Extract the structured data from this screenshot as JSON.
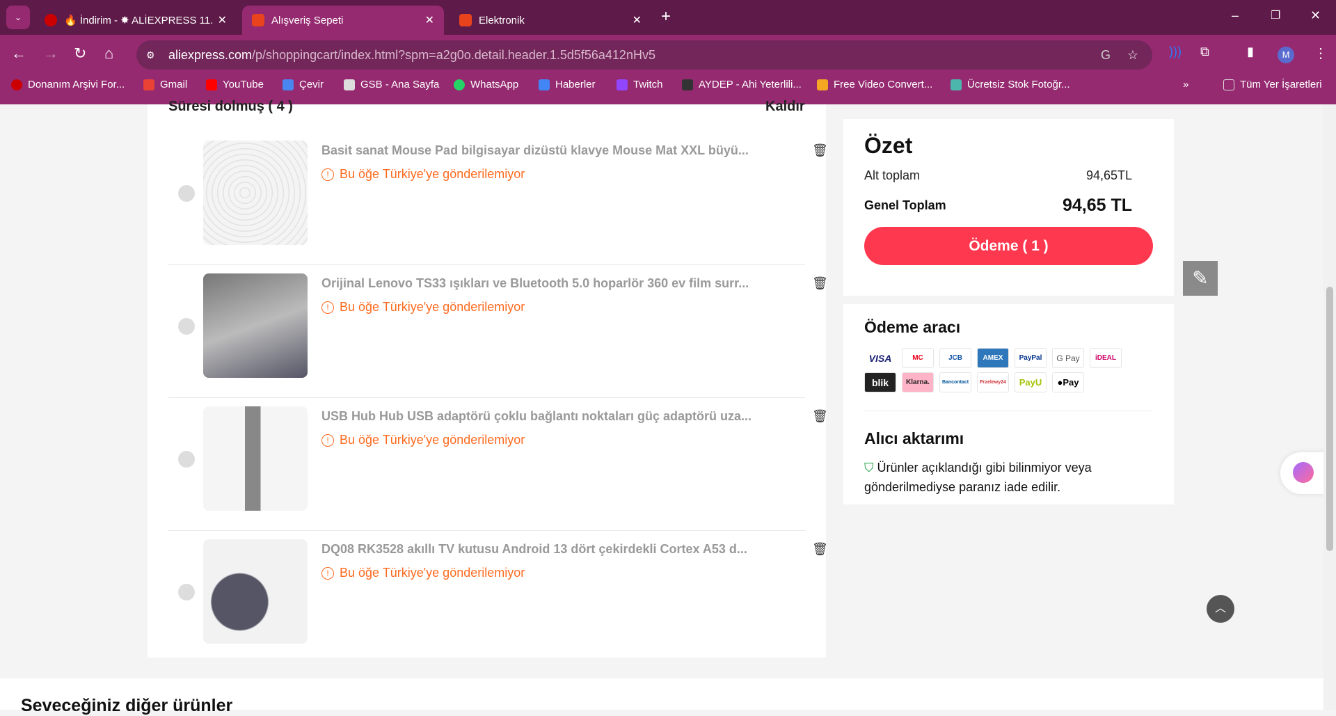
{
  "browser": {
    "tabs": [
      {
        "label": "🔥 İndirim - ✸ ALİEXPRESS 11.",
        "active": false
      },
      {
        "label": "Alışveriş Sepeti",
        "active": true
      },
      {
        "label": "Elektronik",
        "active": false
      }
    ],
    "url_host": "aliexpress.com",
    "url_path": "/p/shoppingcart/index.html?spm=a2g0o.detail.header.1.5d5f56a412nHv5",
    "profile": "M",
    "bookmarks": [
      "Donanım Arşivi For...",
      "Gmail",
      "YouTube",
      "Çevir",
      "GSB - Ana Sayfa",
      "WhatsApp",
      "Haberler",
      "Twitch",
      "AYDEP - Ahi Yeterlili...",
      "Free Video Convert...",
      "Ücretsiz Stok Fotoğr..."
    ],
    "all_bookmarks": "Tüm Yer İşaretleri"
  },
  "cart": {
    "section_title": "Süresi dolmuş ( 4 )",
    "remove_label": "Kaldır",
    "items": [
      {
        "title": "Basit sanat Mouse Pad bilgisayar dizüstü klavye Mouse Mat XXL büyü...",
        "warning": "Bu öğe Türkiye'ye gönderilemiyor"
      },
      {
        "title": "Orijinal Lenovo TS33 ışıkları ve Bluetooth 5.0 hoparlör 360 ev film surr...",
        "warning": "Bu öğe Türkiye'ye gönderilemiyor"
      },
      {
        "title": "USB Hub Hub USB adaptörü çoklu bağlantı noktaları güç adaptörü uza...",
        "warning": "Bu öğe Türkiye'ye gönderilemiyor"
      },
      {
        "title": "DQ08 RK3528 akıllı TV kutusu Android 13 dört çekirdekli Cortex A53 d...",
        "warning": "Bu öğe Türkiye'ye gönderilemiyor"
      }
    ]
  },
  "summary": {
    "title": "Özet",
    "subtotal_label": "Alt toplam",
    "subtotal": "94,65TL",
    "total_label": "Genel Toplam",
    "total": "94,65 TL",
    "checkout": "Ödeme ( 1 )"
  },
  "payment": {
    "title": "Ödeme aracı",
    "methods": [
      "VISA",
      "MC",
      "JCB",
      "AMEX",
      "PayPal",
      "G Pay",
      "iDEAL",
      "blik",
      "Klarna.",
      "Bancontact",
      "Przelewy24",
      "PayU",
      "Pay"
    ]
  },
  "protection": {
    "title": "Alıcı aktarımı",
    "text": "Ürünler açıklandığı gibi bilinmiyor veya gönderilmediyse paranız iade edilir."
  },
  "recommend_title": "Seveceğiniz diğer ürünler"
}
